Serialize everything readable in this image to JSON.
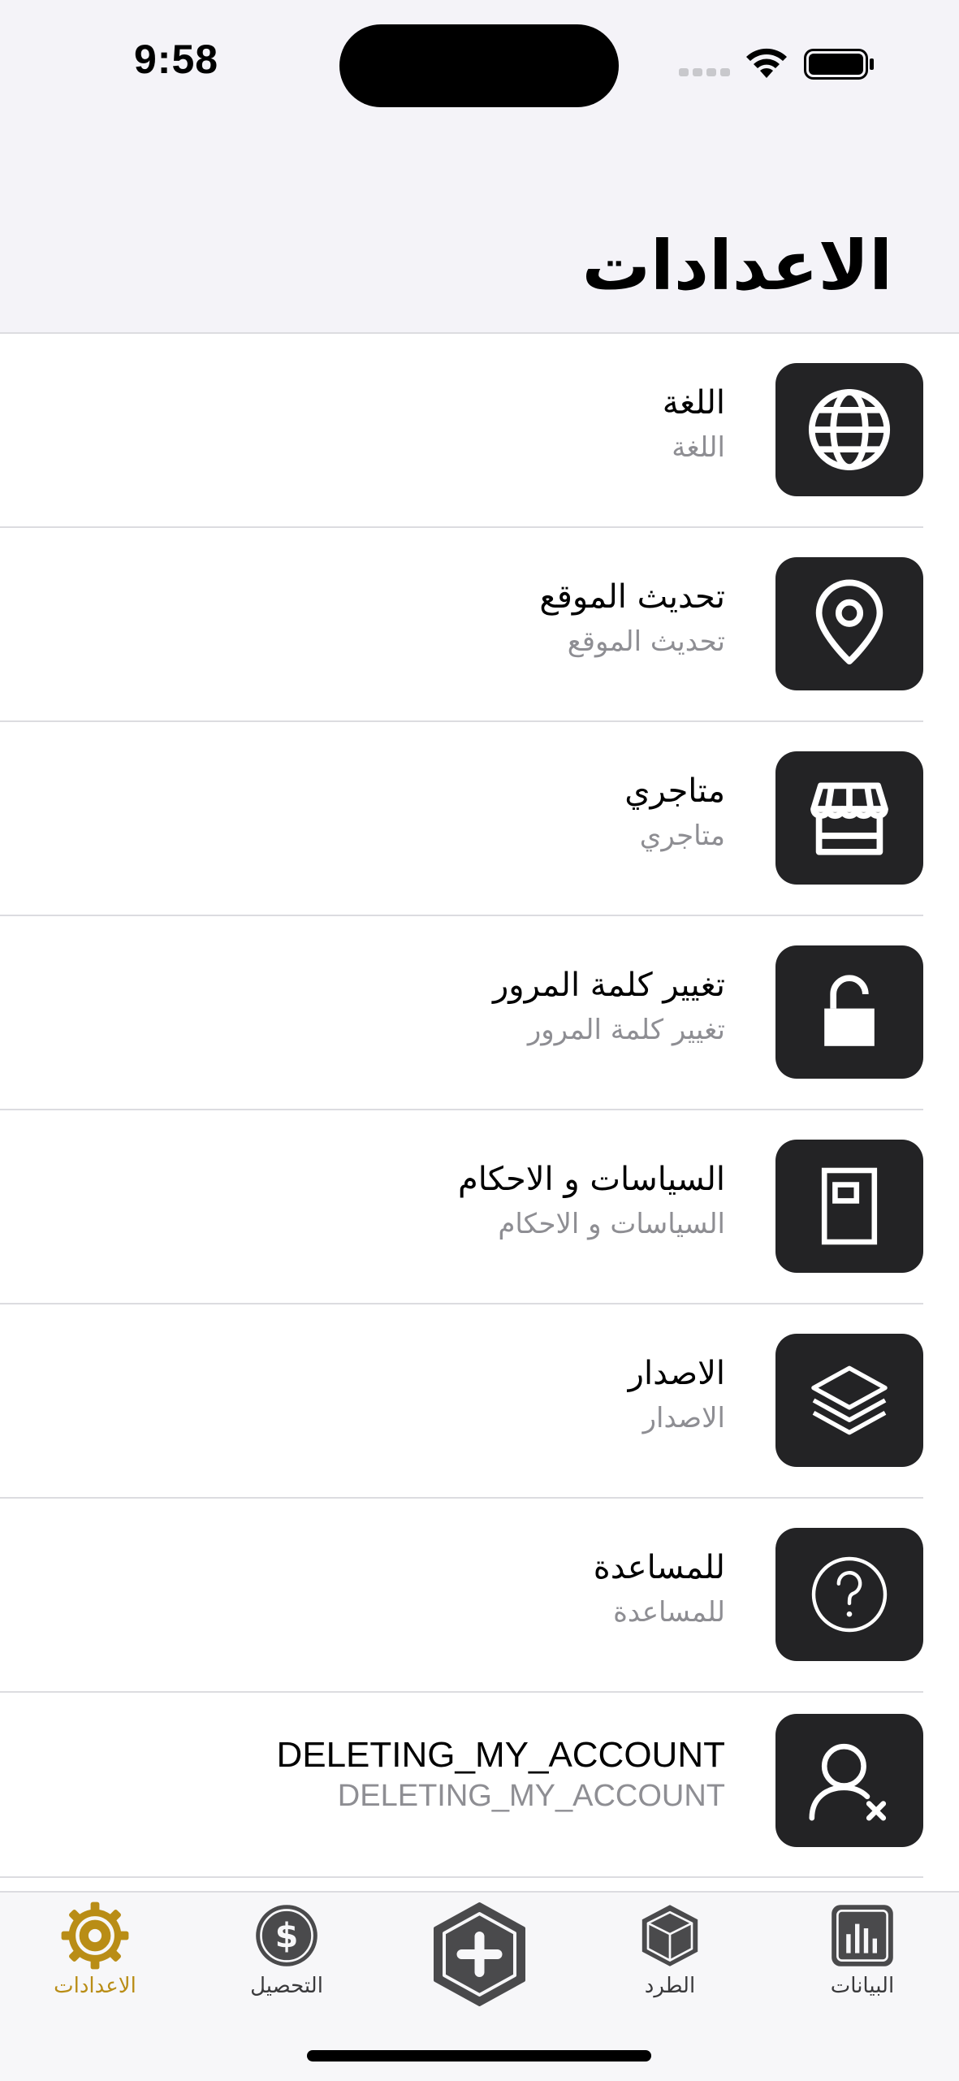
{
  "status_bar": {
    "time": "9:58"
  },
  "header": {
    "title": "الاعدادات"
  },
  "settings": [
    {
      "title": "اللغة",
      "subtitle": "اللغة",
      "icon": "globe-icon"
    },
    {
      "title": "تحديث الموقع",
      "subtitle": "تحديث الموقع",
      "icon": "location-pin-icon"
    },
    {
      "title": "متاجري",
      "subtitle": "متاجري",
      "icon": "store-icon"
    },
    {
      "title": "تغيير كلمة المرور",
      "subtitle": "تغيير كلمة المرور",
      "icon": "unlock-icon"
    },
    {
      "title": "السياسات و الاحكام",
      "subtitle": "السياسات و الاحكام",
      "icon": "document-icon"
    },
    {
      "title": "الاصدار",
      "subtitle": "الاصدار",
      "icon": "layers-icon"
    },
    {
      "title": "للمساعدة",
      "subtitle": "للمساعدة",
      "icon": "help-icon"
    },
    {
      "title": "DELETING_MY_ACCOUNT",
      "subtitle": "DELETING_MY_ACCOUNT",
      "icon": "delete-account-icon"
    }
  ],
  "tab_bar": {
    "tabs": [
      {
        "label": "الاعدادات",
        "icon": "gear-icon",
        "active": true
      },
      {
        "label": "التحصيل",
        "icon": "dollar-icon",
        "active": false
      },
      {
        "label": "",
        "icon": "add-icon",
        "active": false
      },
      {
        "label": "الطرد",
        "icon": "package-icon",
        "active": false
      },
      {
        "label": "البيانات",
        "icon": "chart-icon",
        "active": false
      }
    ]
  },
  "colors": {
    "accent": "#b98d16",
    "tile": "#232325",
    "header_bg": "#f4f3f8",
    "subtitle": "#8e8e93"
  }
}
